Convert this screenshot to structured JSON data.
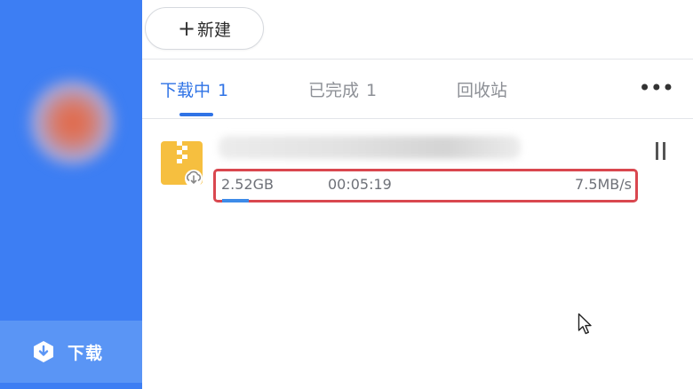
{
  "toolbar": {
    "new_plus": "+",
    "new_label": "新建"
  },
  "tabs": [
    {
      "label": "下载中",
      "count": "1",
      "active": true
    },
    {
      "label": "已完成",
      "count": "1",
      "active": false
    },
    {
      "label": "回收站",
      "count": "",
      "active": false
    }
  ],
  "more_menu": "•••",
  "sidebar": {
    "download_label": "下载"
  },
  "download_item": {
    "size": "2.52GB",
    "time_remaining": "00:05:19",
    "speed": "7.5MB/s",
    "progress_fraction": 0.06
  },
  "icons": {
    "file": "zip-cloud-file-icon",
    "pause": "pause-icon",
    "nav": "download-shield-icon"
  },
  "colors": {
    "sidebar": "#3d7ef3",
    "accent": "#2f73e6",
    "highlight_box": "#d9474f"
  }
}
